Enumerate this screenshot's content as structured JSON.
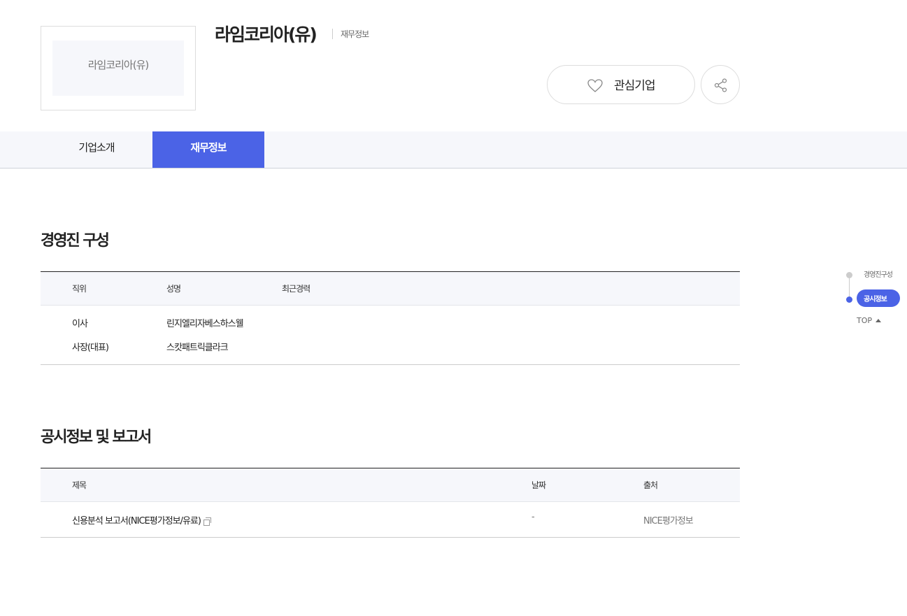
{
  "header": {
    "logo_text": "라임코리아(유)",
    "company_name": "라임코리아(유)",
    "subtitle": "재무정보",
    "favorite_label": "관심기업",
    "share_icon": "share-icon",
    "heart_icon": "heart-icon"
  },
  "tabs": [
    {
      "label": "기업소개",
      "active": false
    },
    {
      "label": "재무정보",
      "active": true
    }
  ],
  "executives": {
    "title": "경영진 구성",
    "columns": [
      "직위",
      "성명",
      "최근경력"
    ],
    "rows": [
      {
        "position": "이사",
        "name": "린지엘리자베스하스웰",
        "career": ""
      },
      {
        "position": "사장(대표)",
        "name": "스캇패트릭클라크",
        "career": ""
      }
    ]
  },
  "disclosures": {
    "title": "공시정보 및 보고서",
    "columns": [
      "제목",
      "날짜",
      "출처"
    ],
    "rows": [
      {
        "title": "신용분석 보고서(NICE평가정보/유료)",
        "date": "-",
        "source": "NICE평가정보"
      }
    ]
  },
  "side_nav": {
    "items": [
      {
        "label": "경영진구성",
        "active": false
      },
      {
        "label": "공시정보",
        "active": true
      }
    ],
    "top_label": "TOP"
  },
  "colors": {
    "accent": "#4b63e6",
    "tab_bg": "#f6f7fb",
    "border": "#dddddd"
  }
}
